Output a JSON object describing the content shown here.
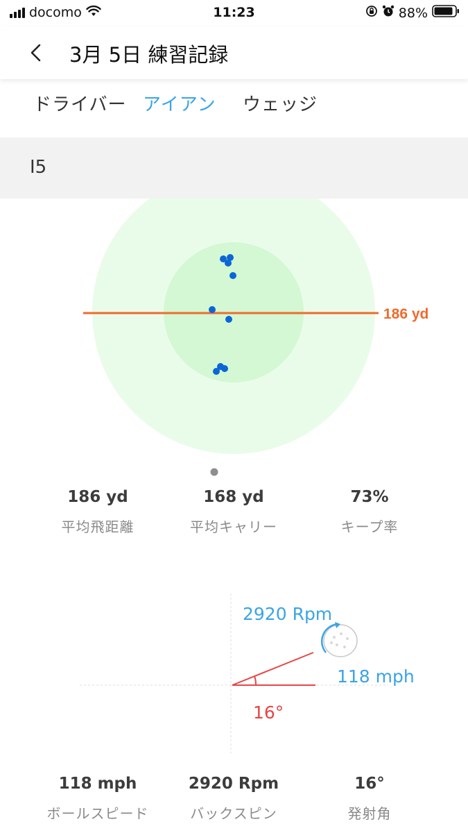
{
  "status_bar": {
    "carrier": "docomo",
    "time": "11:23",
    "battery": "88%"
  },
  "header": {
    "title": "3月 5日 練習記録"
  },
  "tabs": [
    {
      "label": "ドライバー",
      "active": false
    },
    {
      "label": "アイアン",
      "active": true
    },
    {
      "label": "ウェッジ",
      "active": false
    }
  ],
  "club": {
    "label": "I5"
  },
  "dispersion": {
    "target_label": "186 yd"
  },
  "stats": [
    {
      "value": "186 yd",
      "label": "平均飛距離"
    },
    {
      "value": "168 yd",
      "label": "平均キャリー"
    },
    {
      "value": "73%",
      "label": "キープ率"
    }
  ],
  "launch": {
    "spin": "2920 Rpm",
    "speed": "118 mph",
    "angle": "16°"
  },
  "launch_stats": [
    {
      "value": "118 mph",
      "label": "ボールスピード"
    },
    {
      "value": "2920 Rpm",
      "label": "バックスピン"
    },
    {
      "value": "16°",
      "label": "発射角"
    }
  ],
  "colors": {
    "accent": "#3aa4e6",
    "target_line": "#f06a2c",
    "shot_dot": "#0b66d6",
    "zone_outer": "#e9fce9",
    "zone_inner": "#d3f8d3",
    "angle_red": "#e84545"
  }
}
